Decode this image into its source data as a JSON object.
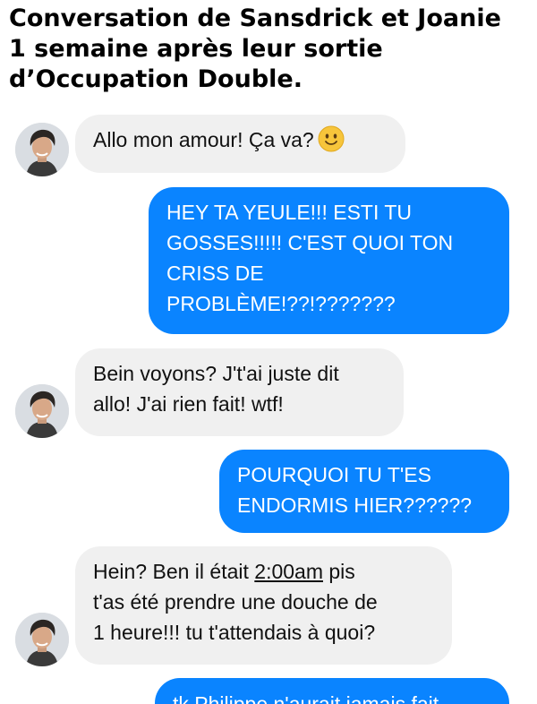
{
  "caption": {
    "line1": "Conversation de Sansdrick et Joanie",
    "line2": "1 semaine après leur sortie",
    "line3": "d’Occupation Double."
  },
  "messages": [
    {
      "side": "received",
      "lines": [
        "Allo mon amour! Ça va?"
      ],
      "emoji": "slightly-smiling-face-icon"
    },
    {
      "side": "sent",
      "lines": [
        "HEY TA YEULE!!! ESTI TU",
        "GOSSES!!!!! C'EST QUOI TON",
        "CRISS DE",
        "PROBLÈME!??!???????"
      ]
    },
    {
      "side": "received",
      "lines": [
        "Bein voyons? J't'ai juste dit",
        "allo! J'ai rien fait! wtf!"
      ]
    },
    {
      "side": "sent",
      "lines": [
        "POURQUOI TU T'ES",
        "ENDORMIS HIER??????"
      ]
    },
    {
      "side": "received",
      "lines": [
        "Hein? Ben il était ",
        "2:00am",
        " pis",
        "t'as été prendre une douche de",
        "1 heure!!! tu t'attendais à quoi?"
      ]
    },
    {
      "side": "sent",
      "lines": [
        "tk Philippe n'aurait jamais fait"
      ]
    }
  ],
  "colors": {
    "received_bubble": "#f0f0f0",
    "sent_bubble": "#0a84ff",
    "sent_text": "#ffffff"
  }
}
